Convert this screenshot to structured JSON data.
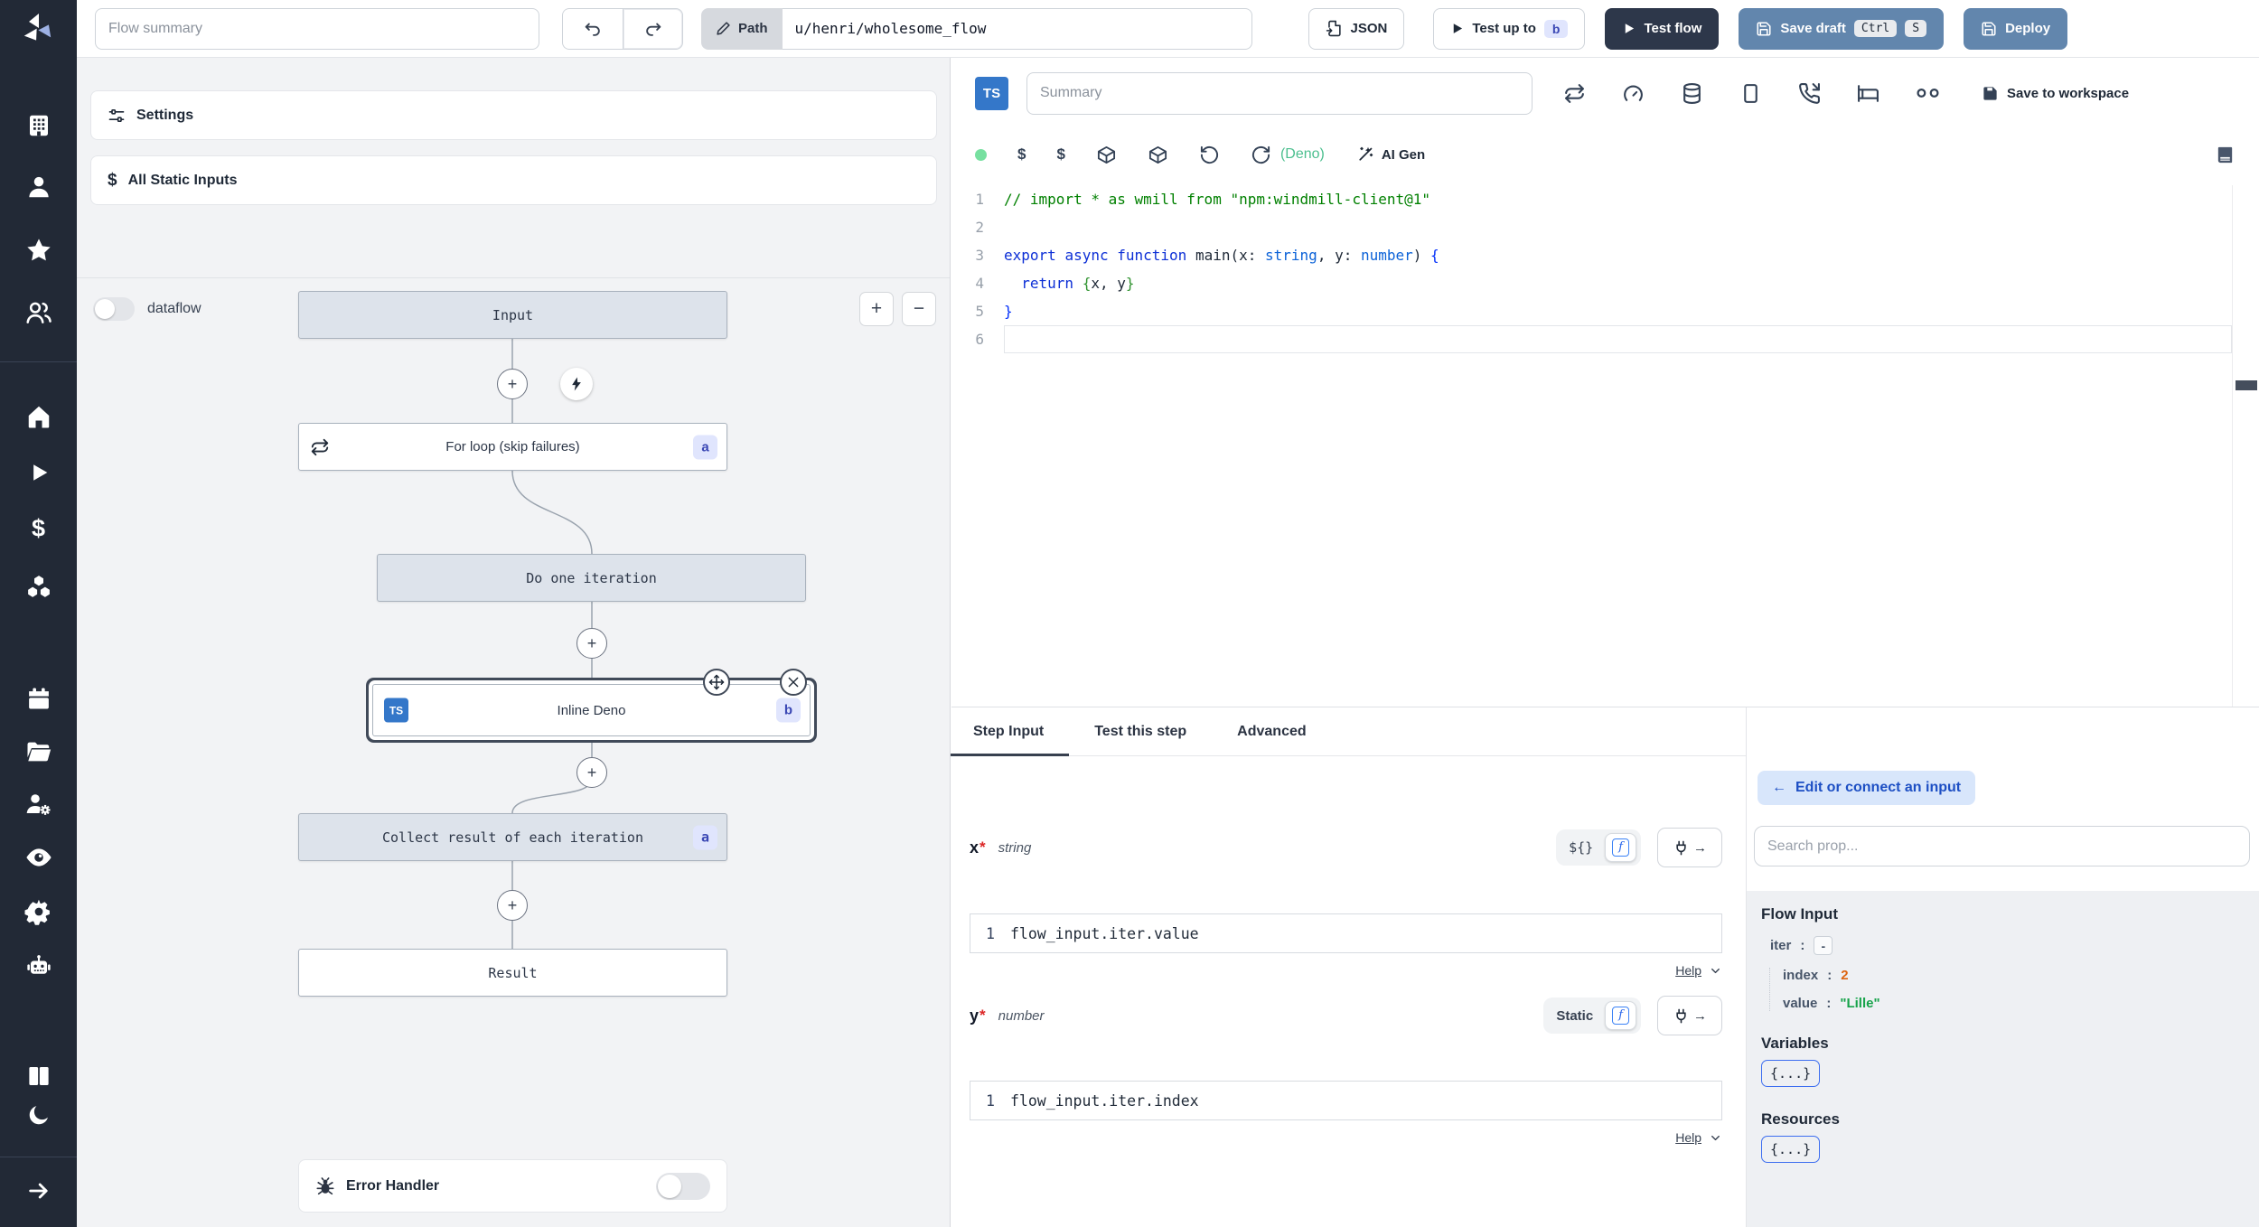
{
  "topbar": {
    "flow_summary_placeholder": "Flow summary",
    "path_label": "Path",
    "path_value": "u/henri/wholesome_flow",
    "json_button": "JSON",
    "test_up_to_label": "Test up to",
    "test_up_to_badge": "b",
    "test_flow_label": "Test flow",
    "save_draft_label": "Save draft",
    "save_draft_kbd": [
      "Ctrl",
      "S"
    ],
    "deploy_label": "Deploy"
  },
  "flow_panel": {
    "settings_label": "Settings",
    "static_inputs_label": "All Static Inputs",
    "static_inputs_icon": "$",
    "dataflow_label": "dataflow",
    "zoom_in": "+",
    "zoom_out": "−",
    "nodes": {
      "input": {
        "label": "Input"
      },
      "for_loop": {
        "label": "For loop (skip failures)",
        "badge": "a"
      },
      "do_one_iteration": {
        "label": "Do one iteration"
      },
      "inline_deno": {
        "label": "Inline Deno",
        "badge": "b",
        "lang": "TS"
      },
      "collect": {
        "label": "Collect result of each iteration",
        "badge": "a"
      },
      "result": {
        "label": "Result"
      },
      "error_handler": {
        "label": "Error Handler"
      }
    },
    "plus_glyph": "+"
  },
  "editor": {
    "lang_badge": "TS",
    "summary_placeholder": "Summary",
    "save_to_workspace_label": "Save to workspace",
    "dollar_icon": "$",
    "runtime_label": "(Deno)",
    "ai_gen_label": "AI Gen",
    "active_line": 6,
    "code_lines": [
      [
        {
          "t": "// import * as wmill from \"npm:windmill-client@1\"",
          "c": "comment"
        }
      ],
      [],
      [
        {
          "t": "export",
          "c": "kw"
        },
        {
          "t": " ",
          "c": "p"
        },
        {
          "t": "async",
          "c": "kw"
        },
        {
          "t": " ",
          "c": "p"
        },
        {
          "t": "function",
          "c": "kw"
        },
        {
          "t": " main(x",
          "c": "p"
        },
        {
          "t": ": ",
          "c": "p"
        },
        {
          "t": "string",
          "c": "type"
        },
        {
          "t": ", y",
          "c": "p"
        },
        {
          "t": ": ",
          "c": "p"
        },
        {
          "t": "number",
          "c": "type"
        },
        {
          "t": ") ",
          "c": "p"
        },
        {
          "t": "{",
          "c": "b1"
        }
      ],
      [
        {
          "t": "  ",
          "c": "p"
        },
        {
          "t": "return",
          "c": "kw"
        },
        {
          "t": " ",
          "c": "p"
        },
        {
          "t": "{",
          "c": "b2"
        },
        {
          "t": "x, y",
          "c": "p"
        },
        {
          "t": "}",
          "c": "b2"
        }
      ],
      [
        {
          "t": "}",
          "c": "b1"
        }
      ],
      []
    ]
  },
  "step_panel": {
    "tabs": [
      "Step Input",
      "Test this step",
      "Advanced"
    ],
    "fields": [
      {
        "name": "x",
        "required": "*",
        "type": "string",
        "mode": "${}",
        "line_no": "1",
        "expr": "flow_input.iter.value",
        "help": "Help"
      },
      {
        "name": "y",
        "required": "*",
        "type": "number",
        "mode": "Static",
        "line_no": "1",
        "expr": "flow_input.iter.index",
        "help": "Help"
      }
    ],
    "fx_glyph": "f",
    "plug_arrow": "→"
  },
  "context_panel": {
    "back_arrow": "←",
    "edit_connect_label": "Edit or connect an input",
    "search_placeholder": "Search prop...",
    "flow_input_title": "Flow Input",
    "tree": [
      {
        "key": "iter",
        "sep": ":",
        "value": "-"
      },
      {
        "key": "index",
        "sep": ":",
        "value": "2"
      },
      {
        "key": "value",
        "sep": ":",
        "value": "\"Lille\""
      }
    ],
    "variables_title": "Variables",
    "variables_value": "{...}",
    "resources_title": "Resources",
    "resources_value": "{...}"
  },
  "colors": {
    "sidebar_bg": "#222936",
    "primary_button_blue": "#6286ad",
    "dark_button": "#2d374a",
    "badge_bg": "#e0e5fd",
    "badge_text": "#3a47b4",
    "ts_blue": "#3477c9",
    "deno_green": "#4cbf8f",
    "status_dot_green": "#77e0a0",
    "value_number_orange": "#dd6410",
    "value_string_green": "#16a34a",
    "edit_connect_bg": "#d8e6fb",
    "edit_connect_text": "#1d4fc4"
  }
}
